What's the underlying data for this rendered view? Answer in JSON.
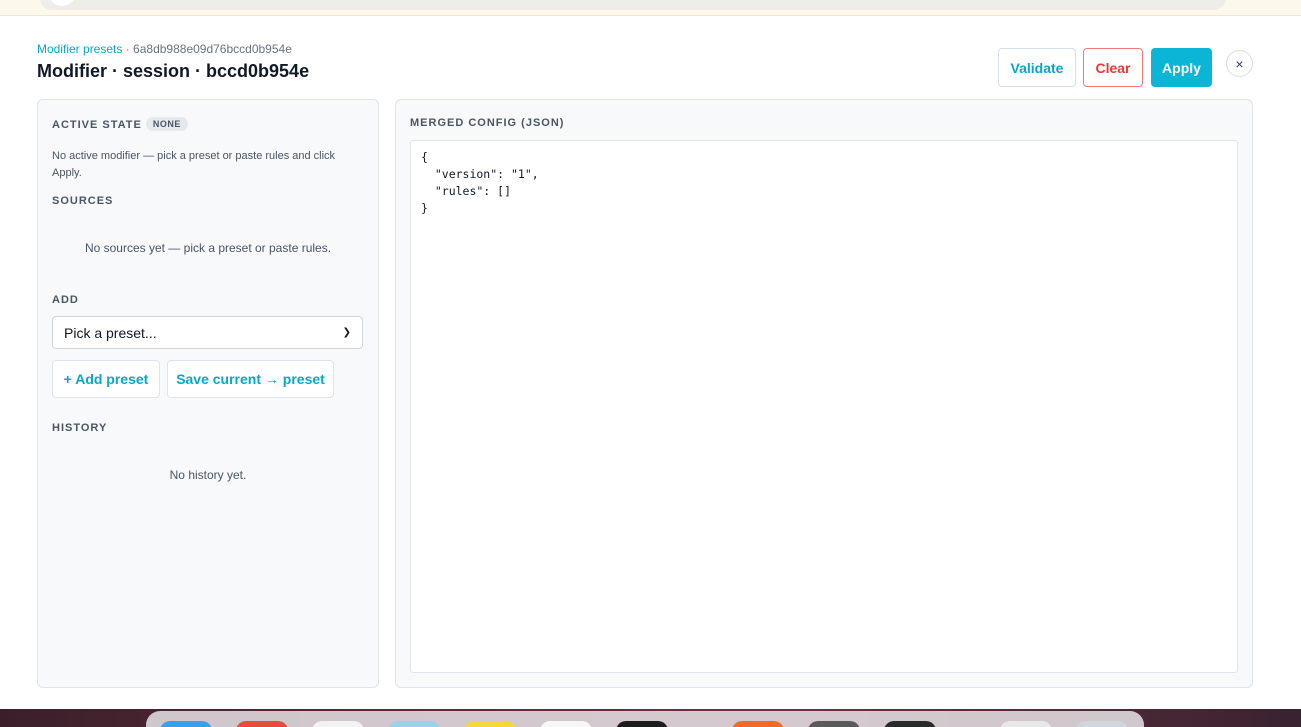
{
  "breadcrumb": {
    "link": "Modifier presets",
    "separator": " · ",
    "id": "6a8db988e09d76bccd0b954e"
  },
  "title": "Modifier · session · bccd0b954e",
  "actions": {
    "validate": "Validate",
    "clear": "Clear",
    "apply": "Apply",
    "close": "×"
  },
  "left": {
    "active_state_label": "ACTIVE STATE",
    "active_state_badge": "NONE",
    "active_note": "No active modifier — pick a preset or paste rules and click Apply.",
    "sources_label": "SOURCES",
    "sources_empty": "No sources yet — pick a preset or paste rules.",
    "add_label": "ADD",
    "preset_select": "Pick a preset...",
    "add_preset_button": "+ Add preset",
    "save_preset_button": "Save current → preset",
    "history_label": "HISTORY",
    "history_empty": "No history yet."
  },
  "right": {
    "merged_label": "MERGED CONFIG (JSON)",
    "json_text": "{\n  \"version\": \"1\",\n  \"rules\": []\n}"
  },
  "colors": {
    "accent": "#0bb5d6",
    "danger": "#e53935",
    "panel_bg": "#f7f9fb"
  }
}
